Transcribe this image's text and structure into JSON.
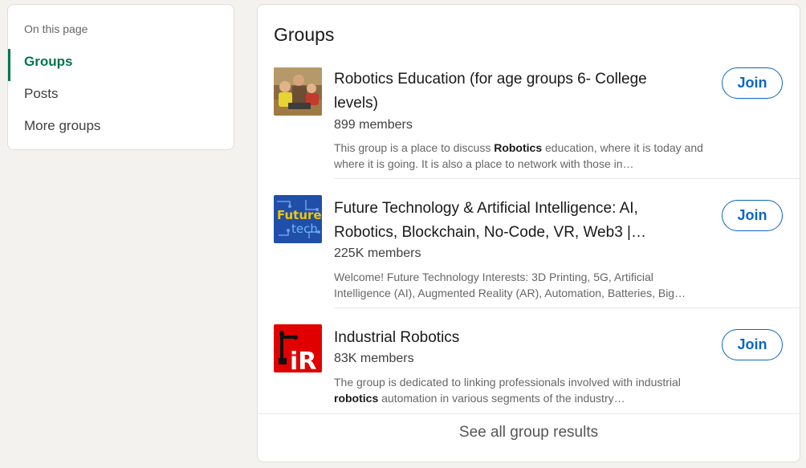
{
  "nav": {
    "heading": "On this page",
    "items": [
      {
        "label": "Groups",
        "active": true
      },
      {
        "label": "Posts",
        "active": false
      },
      {
        "label": "More groups",
        "active": false
      }
    ]
  },
  "groups_card": {
    "title": "Groups",
    "see_all": "See all group results",
    "join_label": "Join",
    "groups": [
      {
        "name": "Robotics Education (for age groups 6- College levels)",
        "members": "899 members",
        "desc_pre": "This group is a place to discuss ",
        "desc_bold": "Robotics",
        "desc_post": " education, where it is today and where it is going. It is also a place to network with those in…",
        "logo": "classroom-photo"
      },
      {
        "name": "Future Technology & Artificial Intelligence: AI, Robotics, Blockchain, No-Code, VR, Web3 |…",
        "members": "225K members",
        "desc_pre": "Welcome! Future Technology Interests: 3D Printing, 5G, Artificial Intelligence (AI), Augmented Reality (AR), Automation, Batteries, Big…",
        "desc_bold": "",
        "desc_post": "",
        "logo": "future-tech-logo",
        "logo_text_1": "Future",
        "logo_text_2": "tech"
      },
      {
        "name": "Industrial Robotics",
        "members": "83K members",
        "desc_pre": "The group is dedicated to linking professionals involved with industrial ",
        "desc_bold": "robotics",
        "desc_post": " automation in various segments of the industry…",
        "logo": "industrial-robotics-logo",
        "logo_text": "iR"
      }
    ]
  },
  "colors": {
    "accent_green": "#01754f",
    "join_blue": "#0a66c2",
    "page_bg": "#f4f2ee"
  }
}
